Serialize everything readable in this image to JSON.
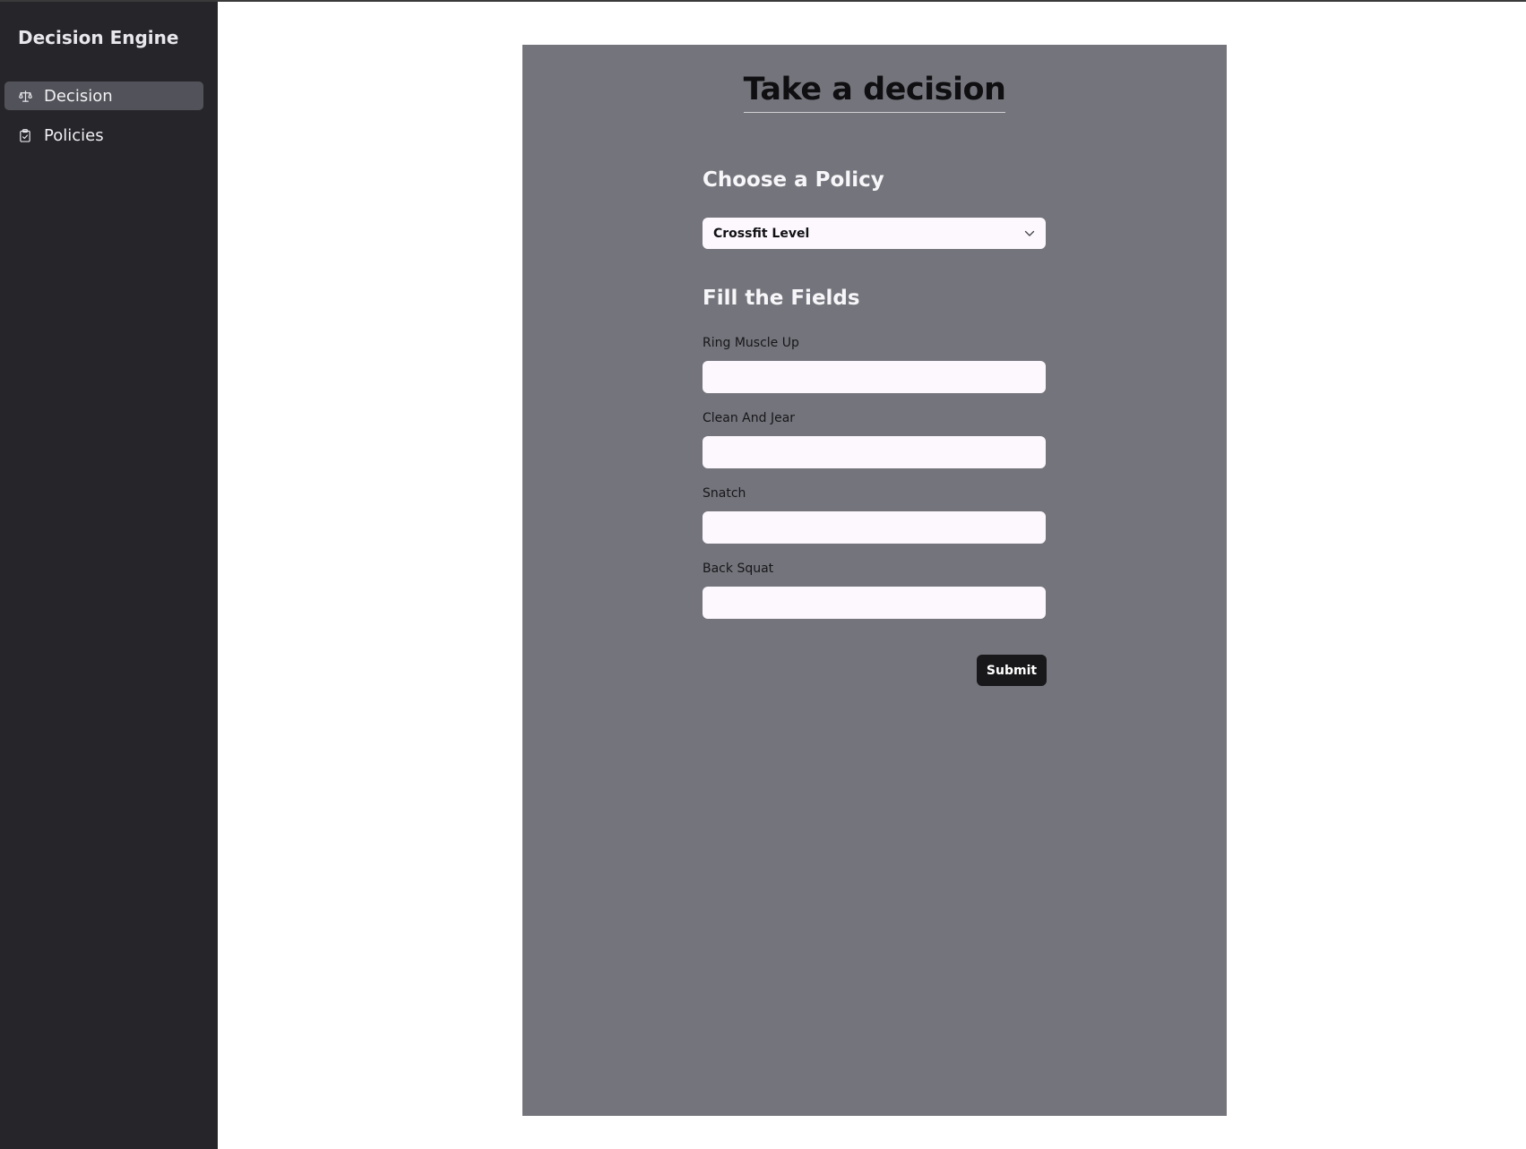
{
  "sidebar": {
    "app_title": "Decision Engine",
    "items": [
      {
        "label": "Decision",
        "icon": "scale-icon",
        "active": true
      },
      {
        "label": "Policies",
        "icon": "clipboard-check-icon",
        "active": false
      }
    ]
  },
  "main": {
    "title": "Take a decision",
    "policy_section": {
      "heading": "Choose a Policy",
      "selected": "Crossfit Level"
    },
    "fields_section": {
      "heading": "Fill the Fields",
      "fields": [
        {
          "label": "Ring Muscle Up",
          "value": ""
        },
        {
          "label": "Clean And Jear",
          "value": ""
        },
        {
          "label": "Snatch",
          "value": ""
        },
        {
          "label": "Back Squat",
          "value": ""
        }
      ]
    },
    "submit_label": "Submit"
  },
  "colors": {
    "sidebar_bg": "#26262a",
    "sidebar_active": "#52525a",
    "panel_bg": "#74747c",
    "input_bg": "#fdf8fd",
    "button_bg": "#18181b"
  }
}
